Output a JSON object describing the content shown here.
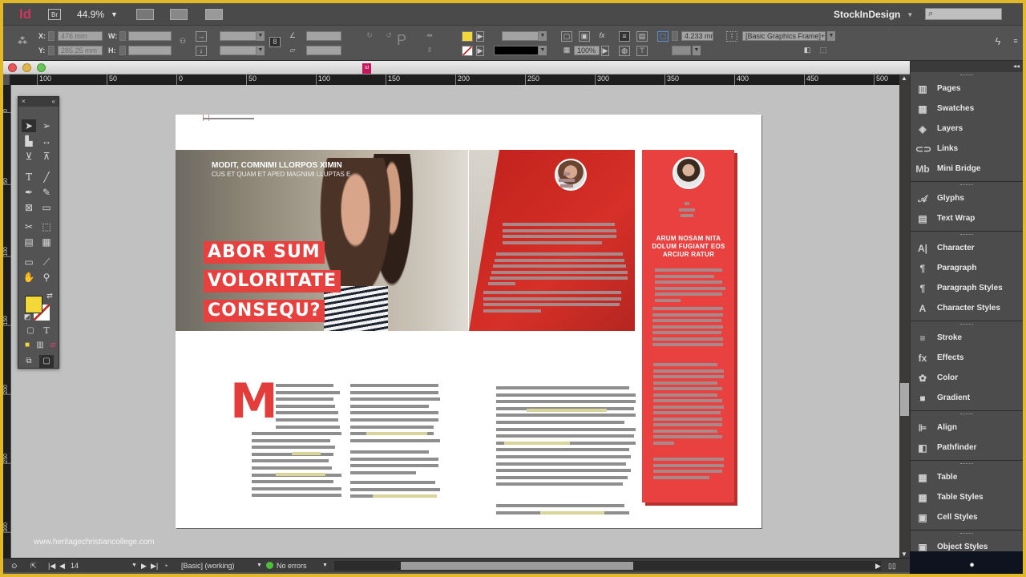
{
  "appbar": {
    "logo": "Id",
    "bridge_label": "Br",
    "zoom": "44.9%",
    "workspace": "StockInDesign",
    "search_placeholder": ""
  },
  "control": {
    "x_label": "X:",
    "x_value": "476 mm",
    "y_label": "Y:",
    "y_value": "285.25 mm",
    "w_label": "W:",
    "w_value": "",
    "h_label": "H:",
    "h_value": "",
    "opacity": "100%",
    "stroke_weight": "4.233 mm",
    "object_style": "[Basic Graphics Frame]+",
    "fill_color": "#f4d83a"
  },
  "ruler": {
    "h_ticks": [
      "100",
      "50",
      "0",
      "50",
      "100",
      "150",
      "200",
      "250",
      "300",
      "350",
      "400",
      "450",
      "500"
    ],
    "v_ticks": [
      "0",
      "50",
      "100",
      "150",
      "200",
      "250",
      "300"
    ]
  },
  "document": {
    "hero_subtitle_1": "MODIT, COMNIMI LLORPOS XIMIN",
    "hero_subtitle_2": "CUS ET QUAM ET APED MAGNIMI LLUPTAS E",
    "headline": [
      "ABOR SUM",
      "VOLORITATE",
      "CONSEQU?"
    ],
    "quote": "ARUM NOSAM NITA DOLUM FUGIANT EOS ARCIUR RATUR",
    "drop_cap": "M",
    "accent_red": "#e84140",
    "highlight": "#d8d49a"
  },
  "watermark": "www.heritagechristiancollege.com",
  "tools_panel": {
    "close": "×",
    "collapse": "«"
  },
  "panels": {
    "groups": [
      [
        {
          "label": "Pages",
          "icon": "pages-icon",
          "glyph": "▥"
        },
        {
          "label": "Swatches",
          "icon": "swatches-icon",
          "glyph": "▦"
        },
        {
          "label": "Layers",
          "icon": "layers-icon",
          "glyph": "◈"
        },
        {
          "label": "Links",
          "icon": "links-icon",
          "glyph": "⊂⊃"
        },
        {
          "label": "Mini Bridge",
          "icon": "mini-bridge-icon",
          "glyph": "Mb"
        }
      ],
      [
        {
          "label": "Glyphs",
          "icon": "glyphs-icon",
          "glyph": "𝒜"
        },
        {
          "label": "Text Wrap",
          "icon": "text-wrap-icon",
          "glyph": "▤"
        }
      ],
      [
        {
          "label": "Character",
          "icon": "character-icon",
          "glyph": "A|"
        },
        {
          "label": "Paragraph",
          "icon": "paragraph-icon",
          "glyph": "¶"
        },
        {
          "label": "Paragraph Styles",
          "icon": "paragraph-styles-icon",
          "glyph": "¶"
        },
        {
          "label": "Character Styles",
          "icon": "character-styles-icon",
          "glyph": "A"
        }
      ],
      [
        {
          "label": "Stroke",
          "icon": "stroke-icon",
          "glyph": "≡"
        },
        {
          "label": "Effects",
          "icon": "effects-icon",
          "glyph": "fx"
        },
        {
          "label": "Color",
          "icon": "color-icon",
          "glyph": "✿"
        },
        {
          "label": "Gradient",
          "icon": "gradient-icon",
          "glyph": "■"
        }
      ],
      [
        {
          "label": "Align",
          "icon": "align-icon",
          "glyph": "⊫"
        },
        {
          "label": "Pathfinder",
          "icon": "pathfinder-icon",
          "glyph": "◧"
        }
      ],
      [
        {
          "label": "Table",
          "icon": "table-icon",
          "glyph": "▦"
        },
        {
          "label": "Table Styles",
          "icon": "table-styles-icon",
          "glyph": "▦"
        },
        {
          "label": "Cell Styles",
          "icon": "cell-styles-icon",
          "glyph": "▣"
        }
      ],
      [
        {
          "label": "Object Styles",
          "icon": "object-styles-icon",
          "glyph": "▣"
        }
      ]
    ]
  },
  "status": {
    "page": "14",
    "style": "[Basic] (working)",
    "errors": "No errors"
  }
}
